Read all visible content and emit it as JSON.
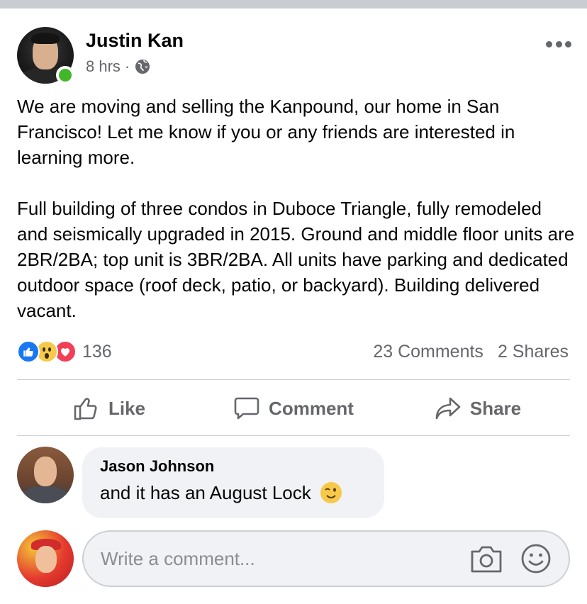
{
  "post": {
    "author": "Justin Kan",
    "time": "8 hrs",
    "separator": "·",
    "privacy_icon": "globe-icon",
    "paragraphs": [
      "We are moving and selling the Kanpound, our home in San Francisco! Let me know if you or any friends are interested in learning more.",
      "Full building of three condos in Duboce Triangle, fully remodeled and seismically upgraded in 2015. Ground and middle floor units are 2BR/2BA; top unit is 3BR/2BA. All units have parking and dedicated outdoor space (roof deck, patio, or backyard). Building delivered vacant."
    ],
    "reactions": {
      "icons": [
        "like-reaction-icon",
        "wow-reaction-icon",
        "love-reaction-icon"
      ],
      "count": "136"
    },
    "comments_count": "23 Comments",
    "shares_count": "2 Shares"
  },
  "actions": {
    "like": "Like",
    "comment": "Comment",
    "share": "Share"
  },
  "comment": {
    "author": "Jason Johnson",
    "text": "and it has an August Lock",
    "emoji_icon": "wink-emoji-icon"
  },
  "composer": {
    "placeholder": "Write a comment..."
  },
  "colors": {
    "online": "#42b72a",
    "like_blue": "#1877f2",
    "love_red": "#f33e58",
    "wow_yellow": "#f7c94a",
    "secondary_text": "#65676b",
    "bubble_bg": "#f0f2f5"
  }
}
